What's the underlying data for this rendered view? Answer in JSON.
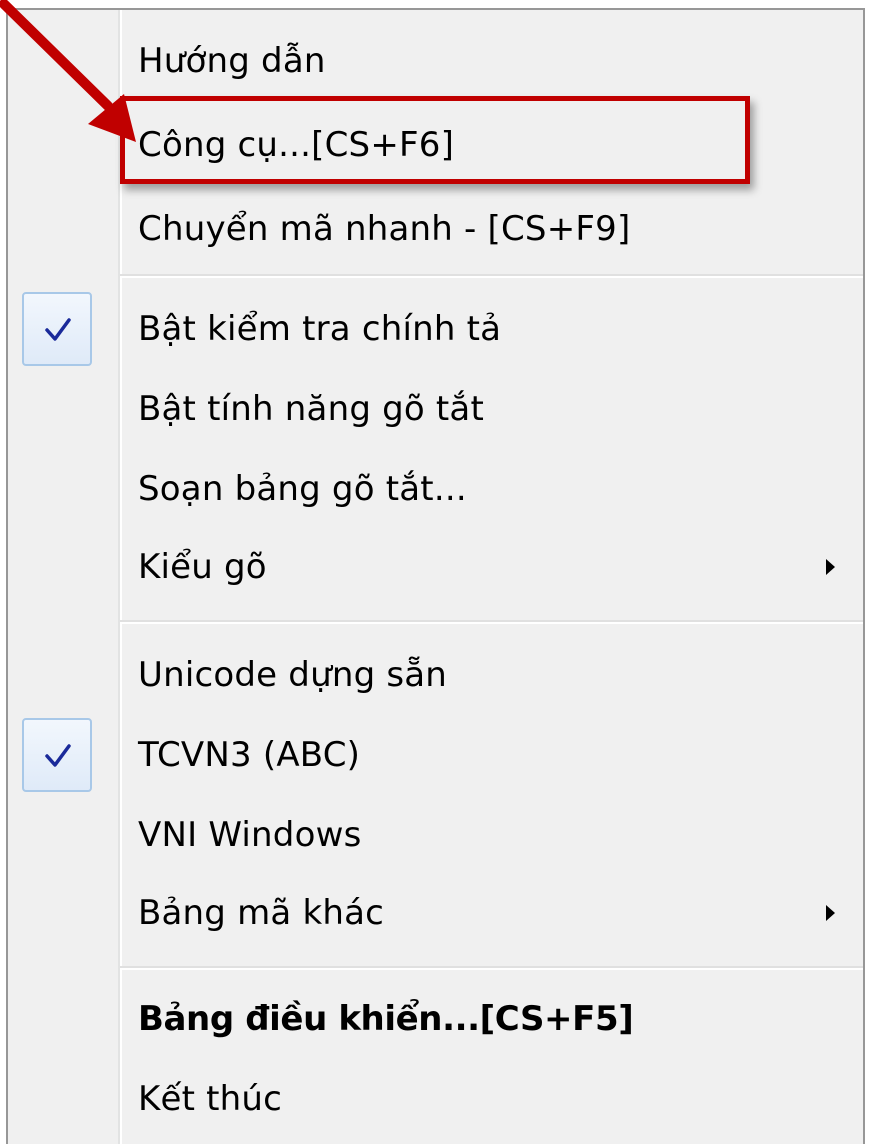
{
  "menu": {
    "items": [
      {
        "label": "Hướng dẫn",
        "checked": false,
        "submenu": false,
        "bold": false
      },
      {
        "label": "Công cụ...[CS+F6]",
        "checked": false,
        "submenu": false,
        "bold": false,
        "highlighted": true
      },
      {
        "label": "Chuyển mã nhanh - [CS+F9]",
        "checked": false,
        "submenu": false,
        "bold": false
      },
      {
        "label": "Bật kiểm tra chính tả",
        "checked": true,
        "submenu": false,
        "bold": false
      },
      {
        "label": "Bật tính năng gõ tắt",
        "checked": false,
        "submenu": false,
        "bold": false
      },
      {
        "label": "Soạn bảng gõ tắt...",
        "checked": false,
        "submenu": false,
        "bold": false
      },
      {
        "label": "Kiểu gõ",
        "checked": false,
        "submenu": true,
        "bold": false
      },
      {
        "label": "Unicode dựng sẵn",
        "checked": false,
        "submenu": false,
        "bold": false
      },
      {
        "label": "TCVN3 (ABC)",
        "checked": true,
        "submenu": false,
        "bold": false
      },
      {
        "label": "VNI Windows",
        "checked": false,
        "submenu": false,
        "bold": false
      },
      {
        "label": "Bảng mã khác",
        "checked": false,
        "submenu": true,
        "bold": false
      },
      {
        "label": "Bảng điều khiển...[CS+F5]",
        "checked": false,
        "submenu": false,
        "bold": true
      },
      {
        "label": "Kết thúc",
        "checked": false,
        "submenu": false,
        "bold": false
      }
    ]
  },
  "colors": {
    "menu_background": "#f0f0f0",
    "annotation_red": "#c00000",
    "check_color": "#1a2a9a"
  },
  "icons": {
    "check": "check-icon",
    "submenu": "submenu-arrow-icon",
    "annotation": "annotation-arrow-icon"
  }
}
